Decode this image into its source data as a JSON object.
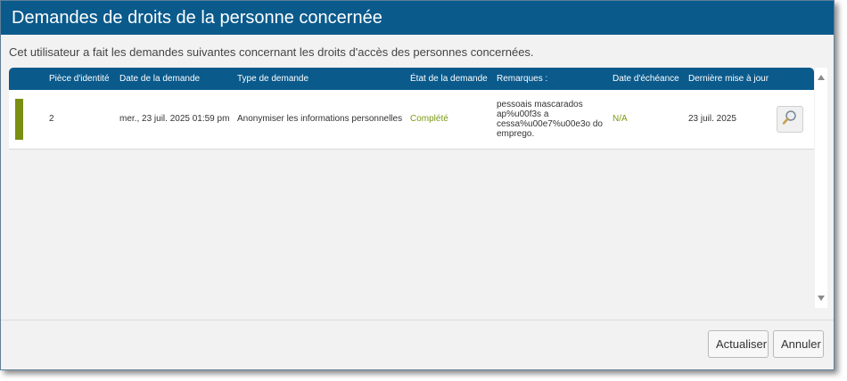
{
  "dialog": {
    "title": "Demandes de droits de la personne concernée",
    "description": "Cet utilisateur a fait les demandes suivantes concernant les droits d'accès des personnes concernées."
  },
  "grid": {
    "columns": [
      "Pièce d'identité",
      "Date de la demande",
      "Type de demande",
      "État de la demande",
      "Remarques :",
      "Date d'échéance",
      "Dernière mise à jour"
    ],
    "rows": [
      {
        "id": "2",
        "request_date": "mer., 23 juil. 2025 01:59 pm",
        "request_type": "Anonymiser les informations personnelles",
        "status": "Complété",
        "remarks": "pessoais mascarados ap%u00f3s a cessa%u00e7%u00e3o do emprego.",
        "due_date": "N/A",
        "last_updated": "23 juil. 2025",
        "status_color": "#7a8f10"
      }
    ]
  },
  "buttons": {
    "refresh": "Actualiser",
    "cancel": "Annuler"
  },
  "colors": {
    "accent": "#0a5a8c",
    "status_complete": "#7a9a10"
  },
  "icons": {
    "view": "magnifier-icon"
  }
}
